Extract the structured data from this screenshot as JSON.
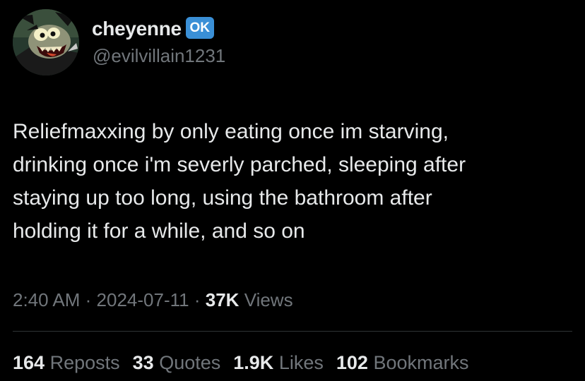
{
  "author": {
    "display_name": "cheyenne",
    "badge_text": "OK",
    "handle": "@evilvillain1231"
  },
  "tweet": {
    "text": "Reliefmaxxing by only eating once im starving,\ndrinking once i'm severly parched, sleeping after\nstaying up too long, using the bathroom after\nholding it for a while, and so on",
    "time": "2:40 AM",
    "date": "2024-07-11",
    "separator": "·",
    "views_count": "37K",
    "views_label": "Views"
  },
  "stats": {
    "reposts": {
      "count": "164",
      "label": "Reposts"
    },
    "quotes": {
      "count": "33",
      "label": "Quotes"
    },
    "likes": {
      "count": "1.9K",
      "label": "Likes"
    },
    "bookmarks": {
      "count": "102",
      "label": "Bookmarks"
    }
  },
  "colors": {
    "background": "#000000",
    "primary_text": "#e7e9ea",
    "secondary_text": "#71767b",
    "badge": "#3a8fd6",
    "divider": "#2f3336"
  },
  "icons": {
    "avatar": "cartoon-villain-avatar",
    "badge": "ok-button-emoji"
  }
}
